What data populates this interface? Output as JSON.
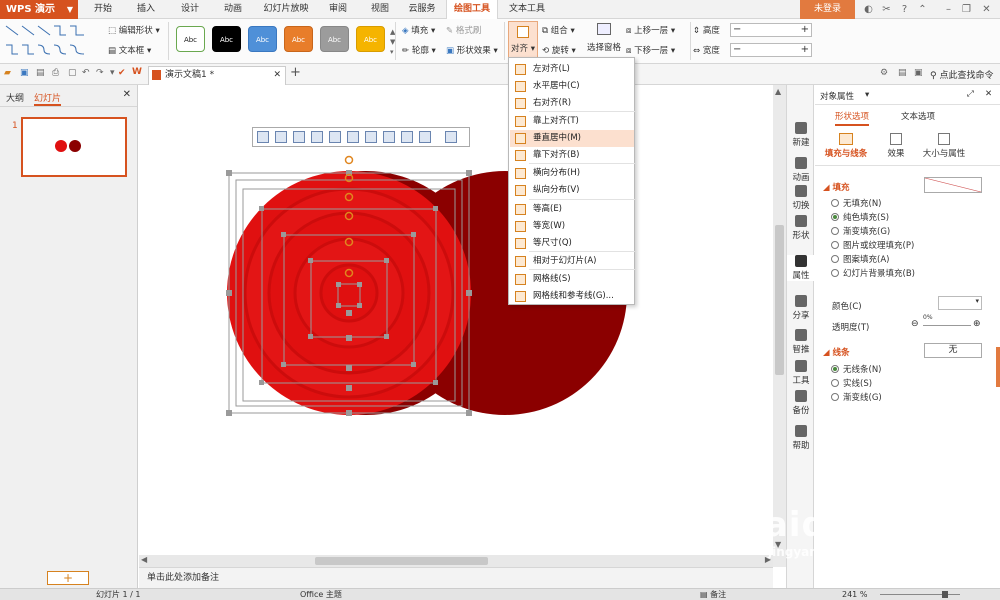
{
  "app": {
    "logo": "WPS 演示",
    "login": "未登录"
  },
  "menu_tabs": [
    "开始",
    "插入",
    "设计",
    "动画",
    "幻灯片放映",
    "审阅",
    "视图",
    "云服务",
    "绘图工具",
    "文本工具"
  ],
  "ribbon": {
    "edit_shape": "编辑形状",
    "text_box": "文本框",
    "style_label": "Abc",
    "fill": "填充",
    "format_brush": "格式刷",
    "outline": "轮廓",
    "shape_effect": "形状效果",
    "align": "对齐",
    "group": "组合",
    "rotate": "旋转",
    "selection_pane": "选择窗格",
    "bring_forward": "上移一层",
    "send_backward": "下移一层",
    "height": "高度",
    "width": "宽度"
  },
  "styles": [
    {
      "bg": "#ffffff",
      "fg": "#222",
      "border": "#6aa84f"
    },
    {
      "bg": "#000000",
      "fg": "#fff",
      "border": "#000"
    },
    {
      "bg": "#4f90d8",
      "fg": "#fff",
      "border": "#3a78c0"
    },
    {
      "bg": "#e87d2a",
      "fg": "#fff",
      "border": "#c8661b"
    },
    {
      "bg": "#9c9c9c",
      "fg": "#fff",
      "border": "#888"
    },
    {
      "bg": "#f5b400",
      "fg": "#fff",
      "border": "#d89c00"
    }
  ],
  "qat": {
    "doc_name": "演示文稿1 *",
    "find_command": "点此查找命令"
  },
  "left_panel": {
    "tab_outline": "大纲",
    "tab_slides": "幻灯片",
    "slide_number": "1"
  },
  "align_menu": {
    "items": [
      "左对齐(L)",
      "水平居中(C)",
      "右对齐(R)",
      "靠上对齐(T)",
      "垂直居中(M)",
      "靠下对齐(B)",
      "横向分布(H)",
      "纵向分布(V)",
      "等高(E)",
      "等宽(W)",
      "等尺寸(Q)",
      "相对于幻灯片(A)",
      "网格线(S)",
      "网格线和参考线(G)..."
    ],
    "highlighted": 4
  },
  "notes": "单击此处添加备注",
  "sidebar": [
    "新建",
    "动画",
    "切换",
    "形状",
    "属性",
    "分享",
    "智推",
    "工具",
    "备份",
    "帮助"
  ],
  "props": {
    "title": "对象属性",
    "tab_shape": "形状选项",
    "tab_text": "文本选项",
    "sub_fill_line": "填充与线条",
    "sub_effect": "效果",
    "sub_size": "大小与属性",
    "fill_header": "填充",
    "fill_options": [
      "无填充(N)",
      "纯色填充(S)",
      "渐变填充(G)",
      "图片或纹理填充(P)",
      "图案填充(A)",
      "幻灯片背景填充(B)"
    ],
    "fill_selected": 1,
    "color_label": "颜色(C)",
    "transparency_label": "透明度(T)",
    "transparency_value": "0%",
    "line_header": "线条",
    "line_value": "无",
    "line_options": [
      "无线条(N)",
      "实线(S)",
      "渐变线(G)"
    ],
    "line_selected": 0
  },
  "status": {
    "slide": "幻灯片 1 / 1",
    "theme": "Office 主题",
    "notes_toggle": "备注",
    "zoom": "241 %"
  },
  "shapes": {
    "red": "#e01010",
    "dark_red": "#8b0000"
  },
  "watermark": {
    "brand": "Baidu经验",
    "url": "jingyan.baidu.com"
  }
}
